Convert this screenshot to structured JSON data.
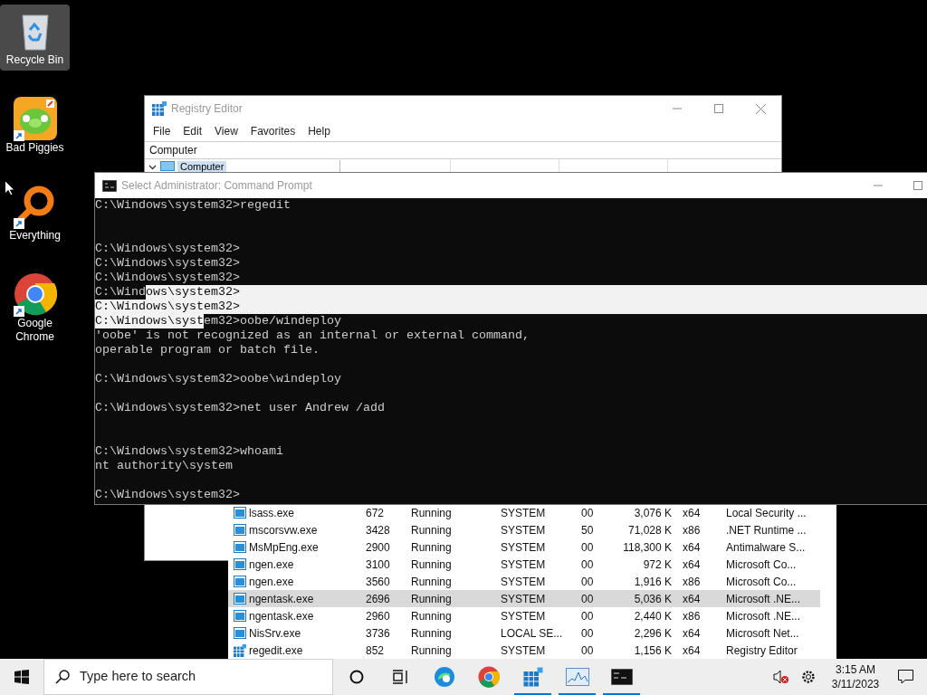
{
  "desktop_icons": [
    {
      "label": "Recycle Bin",
      "selected": true,
      "shortcut": false
    },
    {
      "label": "Bad Piggies",
      "selected": false,
      "shortcut": true
    },
    {
      "label": "Everything",
      "selected": false,
      "shortcut": true
    },
    {
      "label": "Google Chrome",
      "selected": false,
      "shortcut": true
    }
  ],
  "registry_editor": {
    "title": "Registry Editor",
    "menu": [
      "File",
      "Edit",
      "View",
      "Favorites",
      "Help"
    ],
    "address": "Computer",
    "tree": [
      {
        "label": "Computer",
        "expanded": true,
        "selected": true
      }
    ]
  },
  "command_prompt": {
    "title": "Select Administrator: Command Prompt",
    "lines": [
      {
        "kind": "text",
        "fill_rest": false,
        "parts": [
          {
            "text": "C:\\Windows\\system32>regedit",
            "selected": false
          }
        ]
      },
      {
        "kind": "blank"
      },
      {
        "kind": "blank"
      },
      {
        "kind": "text",
        "fill_rest": false,
        "parts": [
          {
            "text": "C:\\Windows\\system32>",
            "selected": false
          }
        ]
      },
      {
        "kind": "text",
        "fill_rest": false,
        "parts": [
          {
            "text": "C:\\Windows\\system32>",
            "selected": false
          }
        ]
      },
      {
        "kind": "text",
        "fill_rest": false,
        "parts": [
          {
            "text": "C:\\Windows\\system32>",
            "selected": false
          }
        ]
      },
      {
        "kind": "text",
        "fill_rest": true,
        "parts": [
          {
            "text": "C:\\Wind",
            "selected": false
          },
          {
            "text": "ows\\system32>",
            "selected": true
          }
        ]
      },
      {
        "kind": "text",
        "fill_rest": true,
        "parts": [
          {
            "text": "C:\\Windows\\system32>",
            "selected": true
          }
        ]
      },
      {
        "kind": "text",
        "fill_rest": false,
        "parts": [
          {
            "text": "C:\\Windows\\syst",
            "selected": true
          },
          {
            "text": "em32>oobe/windeploy",
            "selected": false
          }
        ]
      },
      {
        "kind": "text",
        "fill_rest": false,
        "parts": [
          {
            "text": "'oobe' is not recognized as an internal or external command,",
            "selected": false
          }
        ]
      },
      {
        "kind": "text",
        "fill_rest": false,
        "parts": [
          {
            "text": "operable program or batch file.",
            "selected": false
          }
        ]
      },
      {
        "kind": "blank"
      },
      {
        "kind": "text",
        "fill_rest": false,
        "parts": [
          {
            "text": "C:\\Windows\\system32>oobe\\windeploy",
            "selected": false
          }
        ]
      },
      {
        "kind": "blank"
      },
      {
        "kind": "text",
        "fill_rest": false,
        "parts": [
          {
            "text": "C:\\Windows\\system32>net user Andrew /add",
            "selected": false
          }
        ]
      },
      {
        "kind": "blank"
      },
      {
        "kind": "blank"
      },
      {
        "kind": "text",
        "fill_rest": false,
        "parts": [
          {
            "text": "C:\\Windows\\system32>whoami",
            "selected": false
          }
        ]
      },
      {
        "kind": "text",
        "fill_rest": false,
        "parts": [
          {
            "text": "nt authority\\system",
            "selected": false
          }
        ]
      },
      {
        "kind": "blank"
      },
      {
        "kind": "text",
        "fill_rest": false,
        "parts": [
          {
            "text": "C:\\Windows\\system32>",
            "selected": false
          }
        ]
      }
    ]
  },
  "task_manager": {
    "rows": [
      {
        "name": "lsass.exe",
        "pid": "672",
        "status": "Running",
        "user": "SYSTEM",
        "cpu": "00",
        "memory": "3,076 K",
        "arch": "x64",
        "description": "Local Security ...",
        "selected": false
      },
      {
        "name": "mscorsvw.exe",
        "pid": "3428",
        "status": "Running",
        "user": "SYSTEM",
        "cpu": "50",
        "memory": "71,028 K",
        "arch": "x86",
        "description": ".NET Runtime ...",
        "selected": false
      },
      {
        "name": "MsMpEng.exe",
        "pid": "2900",
        "status": "Running",
        "user": "SYSTEM",
        "cpu": "00",
        "memory": "118,300 K",
        "arch": "x64",
        "description": "Antimalware S...",
        "selected": false
      },
      {
        "name": "ngen.exe",
        "pid": "3100",
        "status": "Running",
        "user": "SYSTEM",
        "cpu": "00",
        "memory": "972 K",
        "arch": "x64",
        "description": "Microsoft Co...",
        "selected": false
      },
      {
        "name": "ngen.exe",
        "pid": "3560",
        "status": "Running",
        "user": "SYSTEM",
        "cpu": "00",
        "memory": "1,916 K",
        "arch": "x86",
        "description": "Microsoft Co...",
        "selected": false
      },
      {
        "name": "ngentask.exe",
        "pid": "2696",
        "status": "Running",
        "user": "SYSTEM",
        "cpu": "00",
        "memory": "5,036 K",
        "arch": "x64",
        "description": "Microsoft .NE...",
        "selected": true
      },
      {
        "name": "ngentask.exe",
        "pid": "2960",
        "status": "Running",
        "user": "SYSTEM",
        "cpu": "00",
        "memory": "2,440 K",
        "arch": "x86",
        "description": "Microsoft .NE...",
        "selected": false
      },
      {
        "name": "NisSrv.exe",
        "pid": "3736",
        "status": "Running",
        "user": "LOCAL SE...",
        "cpu": "00",
        "memory": "2,296 K",
        "arch": "x64",
        "description": "Microsoft Net...",
        "selected": false
      },
      {
        "name": "regedit.exe",
        "pid": "852",
        "status": "Running",
        "user": "SYSTEM",
        "cpu": "00",
        "memory": "1,156 K",
        "arch": "x64",
        "description": "Registry Editor",
        "selected": false
      }
    ]
  },
  "taskbar": {
    "search_placeholder": "Type here to search",
    "apps": [
      {
        "running": false
      },
      {
        "running": false
      },
      {
        "running": true
      },
      {
        "running": true
      },
      {
        "running": true
      }
    ],
    "time": "3:15 AM",
    "date": "3/11/2023"
  }
}
